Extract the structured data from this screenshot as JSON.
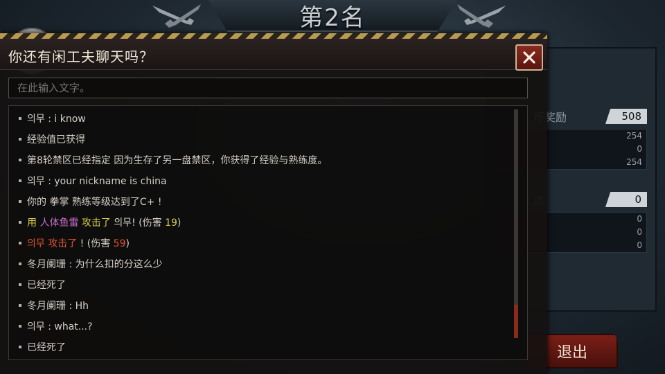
{
  "rank_title": "第2名",
  "right_panel": {
    "coin_reward_label": "币奖励",
    "coin_reward_value": "508",
    "coin_sub_values": [
      "254",
      "0",
      "254"
    ],
    "points_label": "点",
    "points_value": "0",
    "points_sub_values": [
      "0",
      "0",
      "0"
    ]
  },
  "exit_label": "退出",
  "dialog": {
    "title": "你还有闲工夫聊天吗？",
    "close_icon": "close-icon",
    "input_placeholder": "在此输入文字。"
  },
  "chat": {
    "messages": [
      {
        "segments": [
          {
            "text": "의무 : i know",
            "color": "white"
          }
        ]
      },
      {
        "segments": [
          {
            "text": "经验值已获得",
            "color": "white"
          }
        ]
      },
      {
        "segments": [
          {
            "text": "第8轮禁区已经指定 因为生存了另一盘禁区，你获得了经验与熟练度。",
            "color": "white"
          }
        ]
      },
      {
        "segments": [
          {
            "text": "의무 : your nickname is china",
            "color": "white"
          }
        ]
      },
      {
        "segments": [
          {
            "text": "你的 拳掌 熟练等级达到了C+ !",
            "color": "white"
          }
        ]
      },
      {
        "segments": [
          {
            "text": "用 ",
            "color": "yellow"
          },
          {
            "text": "人体鱼雷",
            "color": "purple"
          },
          {
            "text": " 攻击了 ",
            "color": "yellow"
          },
          {
            "text": "의무! (伤害 ",
            "color": "white"
          },
          {
            "text": "19",
            "color": "yellow"
          },
          {
            "text": ")",
            "color": "white"
          }
        ]
      },
      {
        "segments": [
          {
            "text": "의무 ",
            "color": "red"
          },
          {
            "text": "攻击了",
            "color": "red"
          },
          {
            "text": " ! (伤害 ",
            "color": "white"
          },
          {
            "text": "59",
            "color": "red"
          },
          {
            "text": ")",
            "color": "white"
          }
        ]
      },
      {
        "segments": [
          {
            "text": "冬月阑珊 : 为什么扣的分这么少",
            "color": "white"
          }
        ]
      },
      {
        "segments": [
          {
            "text": "已经死了",
            "color": "white"
          }
        ]
      },
      {
        "segments": [
          {
            "text": "冬月阑珊 : Hh",
            "color": "white"
          }
        ]
      },
      {
        "segments": [
          {
            "text": "의무 : what...?",
            "color": "white"
          }
        ]
      },
      {
        "segments": [
          {
            "text": "已经死了",
            "color": "white"
          }
        ]
      }
    ]
  },
  "colors": {
    "accent_red": "#8a2b1f",
    "hazard_yellow": "#b99a52",
    "text_yellow": "#d9cf4a",
    "text_purple": "#c870d0",
    "text_red": "#e0542e"
  },
  "scroll_position": 1.0
}
